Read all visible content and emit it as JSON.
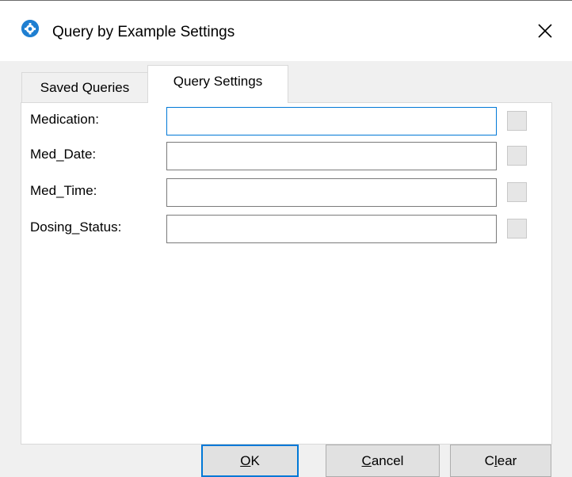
{
  "window": {
    "title": "Query by Example Settings",
    "icon": "app-gear-icon",
    "close_glyph": "✕"
  },
  "tabs": [
    {
      "label": "Saved Queries",
      "active": false
    },
    {
      "label": "Query Settings",
      "active": true
    }
  ],
  "fields": [
    {
      "label": "Medication:",
      "value": "",
      "focused": true
    },
    {
      "label": "Med_Date:",
      "value": ""
    },
    {
      "label": "Med_Time:",
      "value": ""
    },
    {
      "label": "Dosing_Status:",
      "value": ""
    }
  ],
  "buttons": {
    "ok": {
      "label": "OK",
      "mnemonic": "O"
    },
    "cancel": {
      "label": "Cancel",
      "mnemonic": "C"
    },
    "clear": {
      "label": "Clear",
      "mnemonic": "l"
    }
  },
  "colors": {
    "accent": "#0078d7",
    "icon_blue": "#1f7fd1"
  }
}
